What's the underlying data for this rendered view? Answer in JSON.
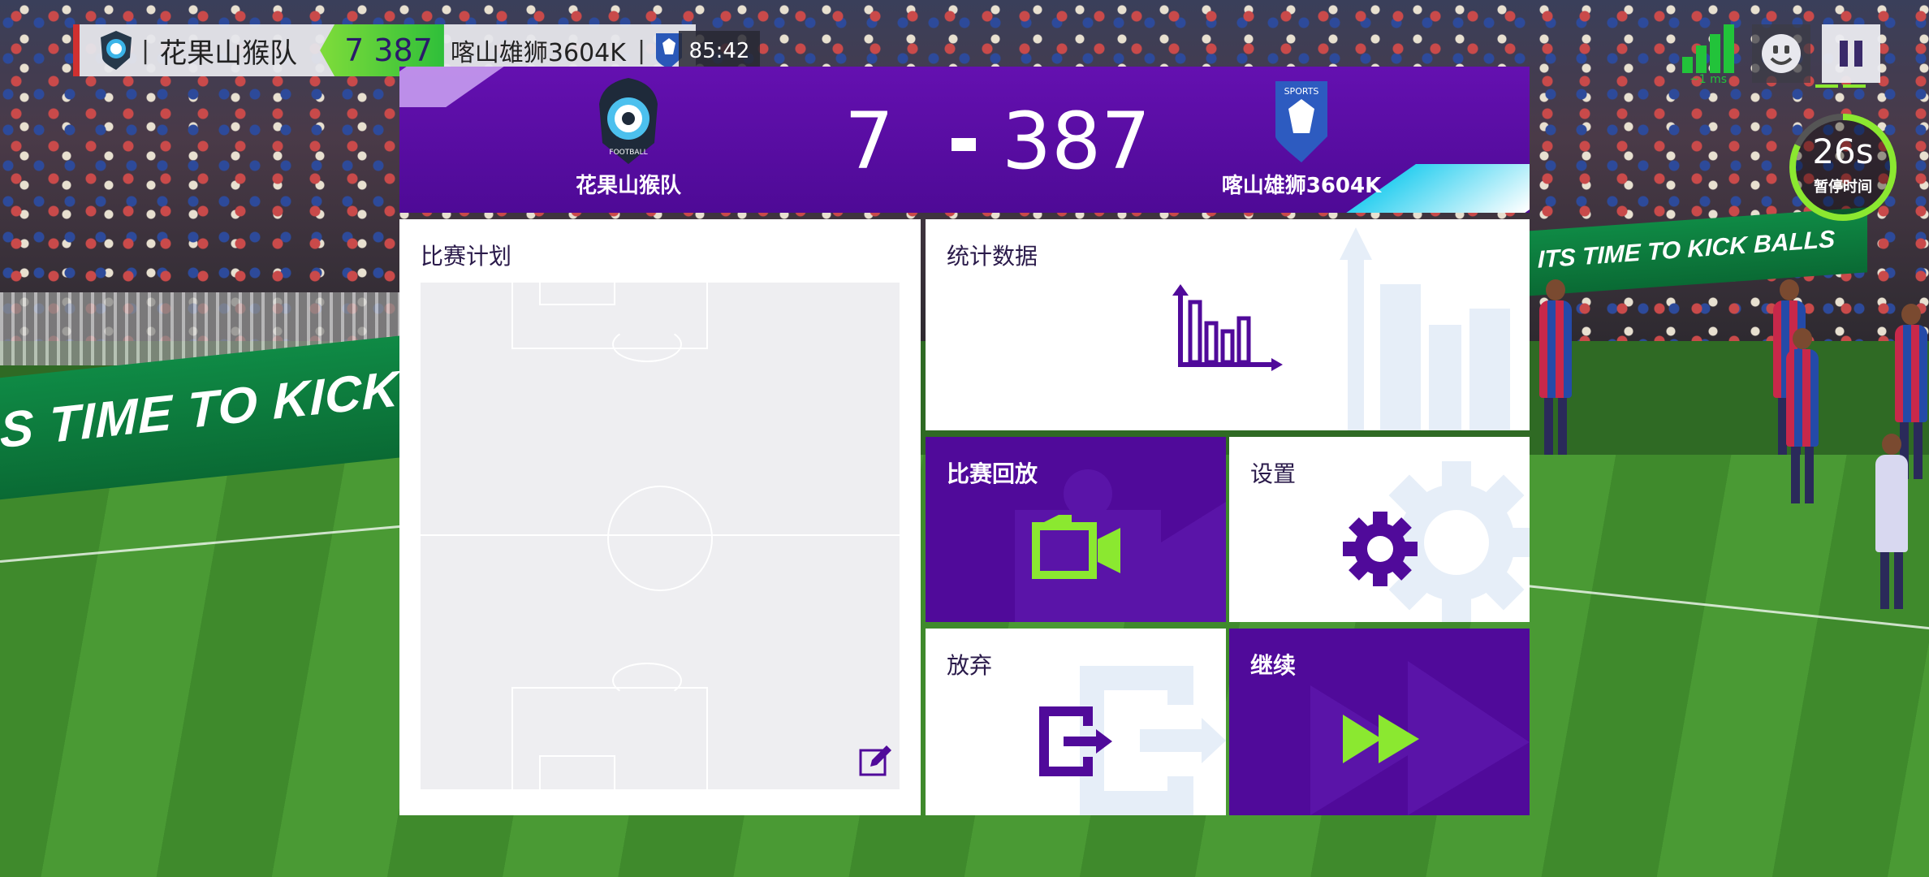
{
  "colors": {
    "menu_purple": "#500a9a",
    "accent_green": "#8be830",
    "signal_green": "#22c33a",
    "ghost_blue": "#e6eef8"
  },
  "hud": {
    "home_team": "花果山猴队",
    "score_text": "7 387",
    "away_team": "喀山雄狮3604K",
    "clock": "85:42",
    "latency": "~1 ms",
    "pause_seconds": "26s",
    "pause_label": "暂停时间",
    "icons": {
      "signal": "signal-strength-icon",
      "emote": "smiley-icon",
      "pause": "pause-icon"
    }
  },
  "background": {
    "ad_left": "S TIME TO KICK BALLS",
    "ad_right": "ITS TIME TO KICK BALLS"
  },
  "menu": {
    "home": {
      "name": "花果山猴队",
      "score": "7",
      "crest_text": "FOOTBALL"
    },
    "away": {
      "name": "喀山雄狮3604K",
      "score": "387",
      "crest_text": "SPORTS"
    },
    "tiles": {
      "plan": {
        "label": "比赛计划",
        "icon": "edit-icon"
      },
      "stats": {
        "label": "统计数据",
        "icon": "bar-chart-icon"
      },
      "replay": {
        "label": "比赛回放",
        "icon": "video-camera-icon"
      },
      "settings": {
        "label": "设置",
        "icon": "gear-icon"
      },
      "quit": {
        "label": "放弃",
        "icon": "exit-icon"
      },
      "resume": {
        "label": "继续",
        "icon": "fast-forward-icon"
      }
    }
  }
}
